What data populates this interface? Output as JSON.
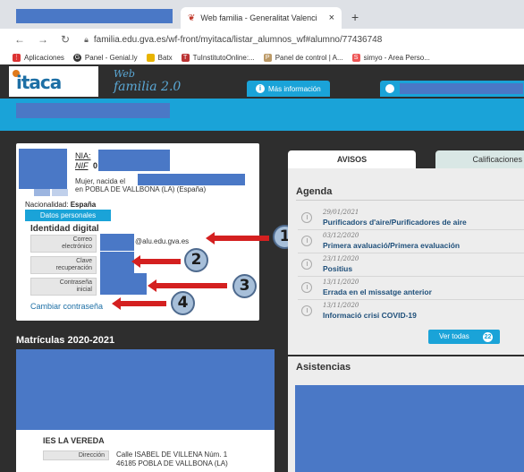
{
  "browser": {
    "tab_title": "Web familia - Generalitat Valenci",
    "tab_close": "×",
    "new_tab": "+",
    "url": "familia.edu.gva.es/wf-front/myitaca/listar_alumnos_wf#alumno/77436748",
    "bookmarks": [
      {
        "label": "Aplicaciones",
        "icon": "apps-grid-icon",
        "color": "#d33"
      },
      {
        "label": "Panel - Genial.ly",
        "icon": "genially-icon",
        "color": "#333"
      },
      {
        "label": "Batx",
        "icon": "folder-icon",
        "color": "#e8b400"
      },
      {
        "label": "TuInstitutoOnline:...",
        "icon": "tuinstituto-icon",
        "color": "#b33"
      },
      {
        "label": "Panel de control | A...",
        "icon": "panel-control-icon",
        "color": "#b96"
      },
      {
        "label": "simyo - Area Perso...",
        "icon": "simyo-icon",
        "color": "#e55"
      }
    ]
  },
  "header": {
    "logo_text": "itaca",
    "app_title_line1": "Web",
    "app_title_line2": "familia 2.0",
    "info_button": "Más información"
  },
  "profile": {
    "nia_label": "NIA:",
    "nif_label": "NIF",
    "nif_prefix": "0",
    "birth_prefix": "Mujer, nacida el",
    "birth_place": "en POBLA DE VALLBONA (LA) (España)",
    "nationality_label": "Nacionalidad:",
    "nationality_value": "España",
    "datos_button": "Datos personales",
    "identity_title": "Identidad digital",
    "fields": [
      {
        "label_line1": "Correo",
        "label_line2": "electrónico"
      },
      {
        "label_line1": "Clave",
        "label_line2": "recuperación"
      },
      {
        "label_line1": "Contraseña",
        "label_line2": "inicial"
      }
    ],
    "email_suffix": "@alu.edu.gva.es",
    "change_password": "Cambiar contraseña"
  },
  "annotations": [
    "1",
    "2",
    "3",
    "4"
  ],
  "matriculas": {
    "title": "Matrículas 2020-2021",
    "school": "IES LA VEREDA",
    "address_label": "Dirección",
    "address_line1": "Calle ISABEL DE VILLENA Núm. 1",
    "address_line2": "46185 POBLA DE VALLBONA (LA)"
  },
  "right_panel": {
    "tab_avisos": "AVISOS",
    "tab_calificaciones": "Calificaciones",
    "agenda_title": "Agenda",
    "events": [
      {
        "date": "29/01/2021",
        "title": "Purificadors d'aire/Purificadores de aire"
      },
      {
        "date": "03/12/2020",
        "title": "Primera avaluació/Primera evaluación"
      },
      {
        "date": "23/11/2020",
        "title": "Positius"
      },
      {
        "date": "13/11/2020",
        "title": "Errada en el missatge anterior"
      },
      {
        "date": "13/11/2020",
        "title": "Informació crisi COVID-19"
      }
    ],
    "see_all": "Ver todas",
    "see_all_count": "22",
    "asistencias_title": "Asistencias"
  },
  "colors": {
    "accent": "#1aa3d8",
    "dark": "#2e2e2e",
    "redaction": "#4a78c6",
    "arrow": "#d42020"
  }
}
